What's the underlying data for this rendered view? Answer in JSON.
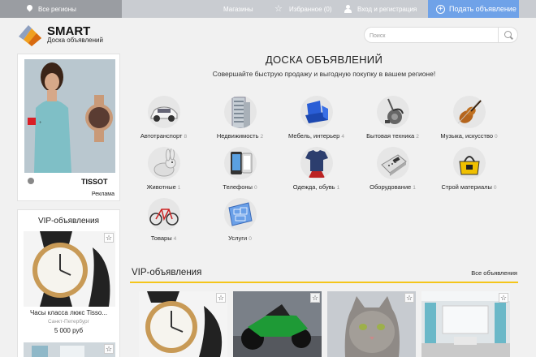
{
  "topbar": {
    "region": "Все регионы",
    "shops": "Магазины",
    "favorites": "Избранное (0)",
    "login": "Вход и регистрация",
    "post_ad": "Подать объявление"
  },
  "header": {
    "brand": "SMART",
    "tagline": "Доска объявлений",
    "search_placeholder": "Поиск"
  },
  "sidebar": {
    "ad_label": "Реклама",
    "vip_title": "VIP-объявления",
    "vip_item": {
      "name": "Часы класса люкс Tisso...",
      "city": "Санкт-Петербург",
      "price": "5 000 руб"
    }
  },
  "main": {
    "title": "ДОСКА ОБЪЯВЛЕНИЙ",
    "subtitle": "Совершайте быструю продажу и выгодную покупку в вашем регионе!",
    "categories": [
      {
        "name": "Автотранспорт",
        "count": "8",
        "icon": "car-icon"
      },
      {
        "name": "Недвижимость",
        "count": "2",
        "icon": "building-icon"
      },
      {
        "name": "Мебель, интерьер",
        "count": "4",
        "icon": "armchair-icon"
      },
      {
        "name": "Бытовая техника",
        "count": "2",
        "icon": "vacuum-icon"
      },
      {
        "name": "Музыка, искусство",
        "count": "0",
        "icon": "violin-icon"
      },
      {
        "name": "Животные",
        "count": "1",
        "icon": "rabbit-icon"
      },
      {
        "name": "Телефоны",
        "count": "0",
        "icon": "phone-icon"
      },
      {
        "name": "Одежда, обувь",
        "count": "1",
        "icon": "tshirt-icon"
      },
      {
        "name": "Оборудование",
        "count": "1",
        "icon": "cash-register-icon"
      },
      {
        "name": "Строй материалы",
        "count": "0",
        "icon": "tools-icon"
      },
      {
        "name": "Товары",
        "count": "4",
        "icon": "bicycle-icon"
      },
      {
        "name": "Услуги",
        "count": "0",
        "icon": "blueprint-icon"
      }
    ],
    "vip_title": "VIP-объявления",
    "all_ads": "Все объявления"
  },
  "colors": {
    "accent_blue": "#6fa2e8",
    "vip_line": "#f4c51a",
    "topbar": "#c9ccd1"
  }
}
